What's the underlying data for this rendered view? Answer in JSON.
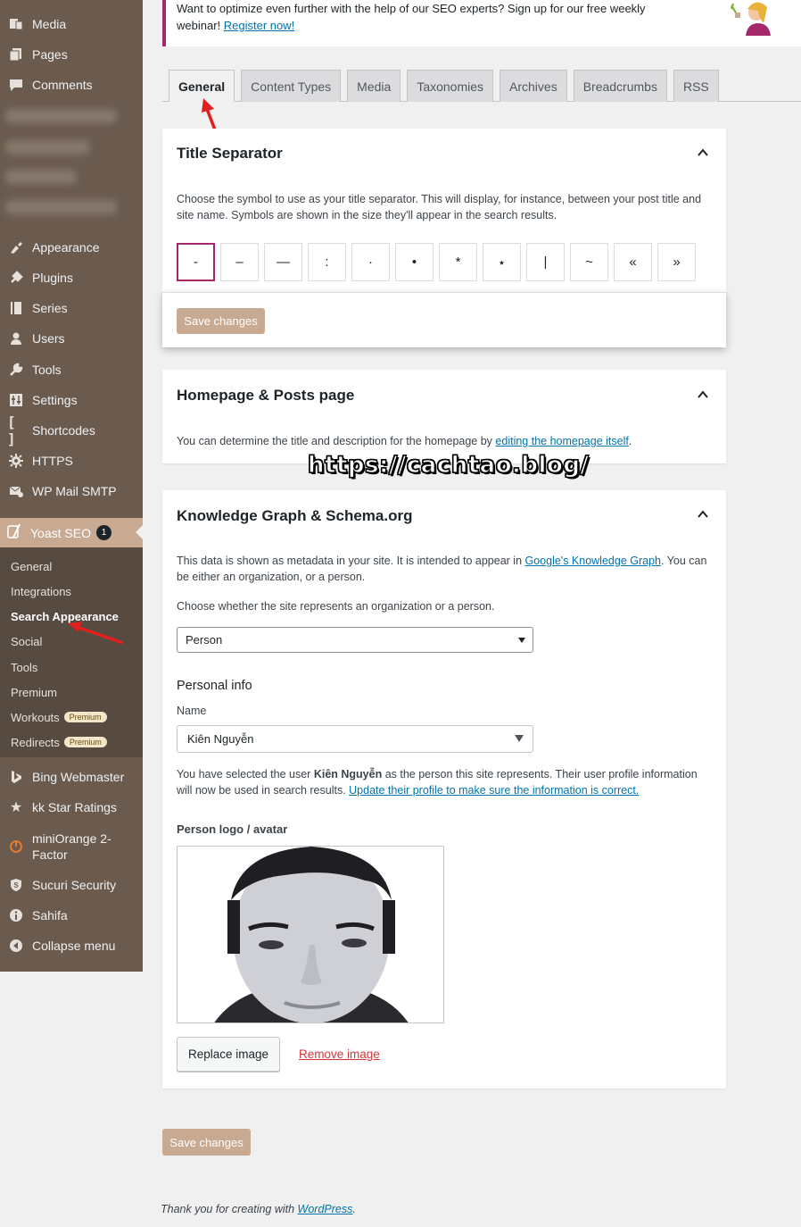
{
  "sidebar": {
    "items_top": [
      {
        "label": "Media",
        "icon": "media-icon"
      },
      {
        "label": "Pages",
        "icon": "pages-icon"
      },
      {
        "label": "Comments",
        "icon": "comments-icon"
      }
    ],
    "items_mid": [
      {
        "label": "Appearance",
        "icon": "appearance-icon"
      },
      {
        "label": "Plugins",
        "icon": "plugins-icon"
      },
      {
        "label": "Series",
        "icon": "series-icon"
      },
      {
        "label": "Users",
        "icon": "users-icon"
      },
      {
        "label": "Tools",
        "icon": "tools-icon"
      },
      {
        "label": "Settings",
        "icon": "settings-icon"
      },
      {
        "label": "Shortcodes",
        "icon": "shortcodes-icon"
      },
      {
        "label": "HTTPS",
        "icon": "https-gear-icon"
      },
      {
        "label": "WP Mail SMTP",
        "icon": "mail-icon"
      }
    ],
    "yoast": {
      "label": "Yoast SEO",
      "count": "1"
    },
    "submenu": [
      {
        "label": "General"
      },
      {
        "label": "Integrations"
      },
      {
        "label": "Search Appearance",
        "current": true
      },
      {
        "label": "Social"
      },
      {
        "label": "Tools"
      },
      {
        "label": "Premium"
      },
      {
        "label": "Workouts",
        "badge": "Premium"
      },
      {
        "label": "Redirects",
        "badge": "Premium"
      }
    ],
    "items_bottom": [
      {
        "label": "Bing Webmaster",
        "icon": "bing-icon"
      },
      {
        "label": "kk Star Ratings",
        "icon": "star-icon"
      },
      {
        "label": "miniOrange 2-Factor",
        "icon": "miniorange-icon"
      },
      {
        "label": "Sucuri Security",
        "icon": "shield-icon"
      },
      {
        "label": "Sahifa",
        "icon": "info-icon"
      },
      {
        "label": "Collapse menu",
        "icon": "collapse-icon"
      }
    ]
  },
  "notice": {
    "text": "Want to optimize even further with the help of our SEO experts? Sign up for our free weekly webinar!",
    "link": "Register now!"
  },
  "tabs": [
    "General",
    "Content Types",
    "Media",
    "Taxonomies",
    "Archives",
    "Breadcrumbs",
    "RSS"
  ],
  "title_separator": {
    "title": "Title Separator",
    "description": "Choose the symbol to use as your title separator. This will display, for instance, between your post title and site name. Symbols are shown in the size they'll appear in the search results.",
    "symbols": [
      "-",
      "–",
      "—",
      ":",
      "·",
      "•",
      "*",
      "⋆",
      "|",
      "~",
      "«",
      "»"
    ],
    "selected": "-"
  },
  "save_label": "Save changes",
  "homepage": {
    "title": "Homepage & Posts page",
    "desc_before": "You can determine the title and description for the homepage by ",
    "desc_link": "editing the homepage itself",
    "desc_after": "."
  },
  "knowledge_graph": {
    "title": "Knowledge Graph & Schema.org",
    "desc_before": "This data is shown as metadata in your site. It is intended to appear in ",
    "desc_link": "Google's Knowledge Graph",
    "desc_after": ". You can be either an organization, or a person.",
    "choose_label": "Choose whether the site represents an organization or a person.",
    "represents_value": "Person",
    "personal_info": "Personal info",
    "name_label": "Name",
    "name_value": "Kiên Nguyễn",
    "selected_before": "You have selected the user ",
    "selected_user": "Kiên Nguyễn",
    "selected_after": " as the person this site represents. Their user profile information will now be used in search results. ",
    "selected_link": "Update their profile to make sure the information is correct.",
    "logo_label": "Person logo / avatar",
    "replace_label": "Replace image",
    "remove_label": "Remove image"
  },
  "watermark": "https://cachtao.blog/",
  "footer": {
    "text": "Thank you for creating with ",
    "link": "WordPress",
    "end": "."
  },
  "colors": {
    "sidebar": "#6b5b4f",
    "accent": "#a4286a",
    "save": "#c8a992",
    "link": "#0073aa"
  }
}
